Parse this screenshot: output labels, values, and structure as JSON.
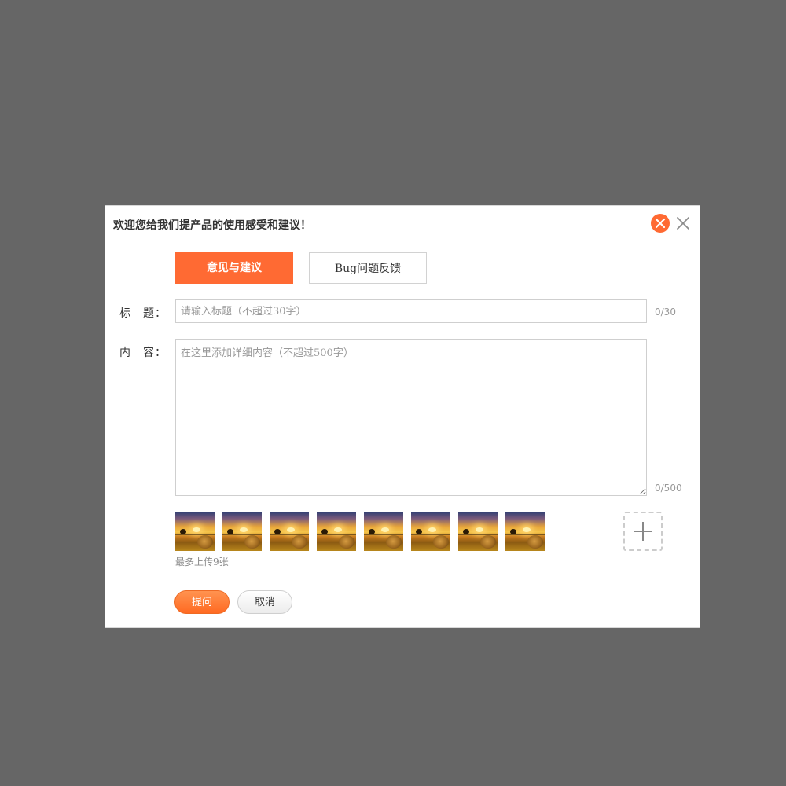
{
  "dialog": {
    "title": "欢迎您给我们提产品的使用感受和建议！",
    "close_icons": [
      "close-circle-icon",
      "close-icon"
    ],
    "accent_color": "#ff6a33"
  },
  "tabs": [
    {
      "label": "意见与建议",
      "active": true
    },
    {
      "label": "Bug问题反馈",
      "active": false
    }
  ],
  "form": {
    "title_label": "标　题：",
    "title_placeholder": "请输入标题（不超过30字）",
    "title_value": "",
    "title_counter": "0/30",
    "content_label": "内　容：",
    "content_placeholder": "在这里添加详细内容（不超过500字）",
    "content_value": "",
    "content_counter": "0/500"
  },
  "images": {
    "count": 8,
    "add_icon": "plus-icon",
    "hint": "最多上传9张"
  },
  "buttons": {
    "submit": "提问",
    "cancel": "取消"
  }
}
